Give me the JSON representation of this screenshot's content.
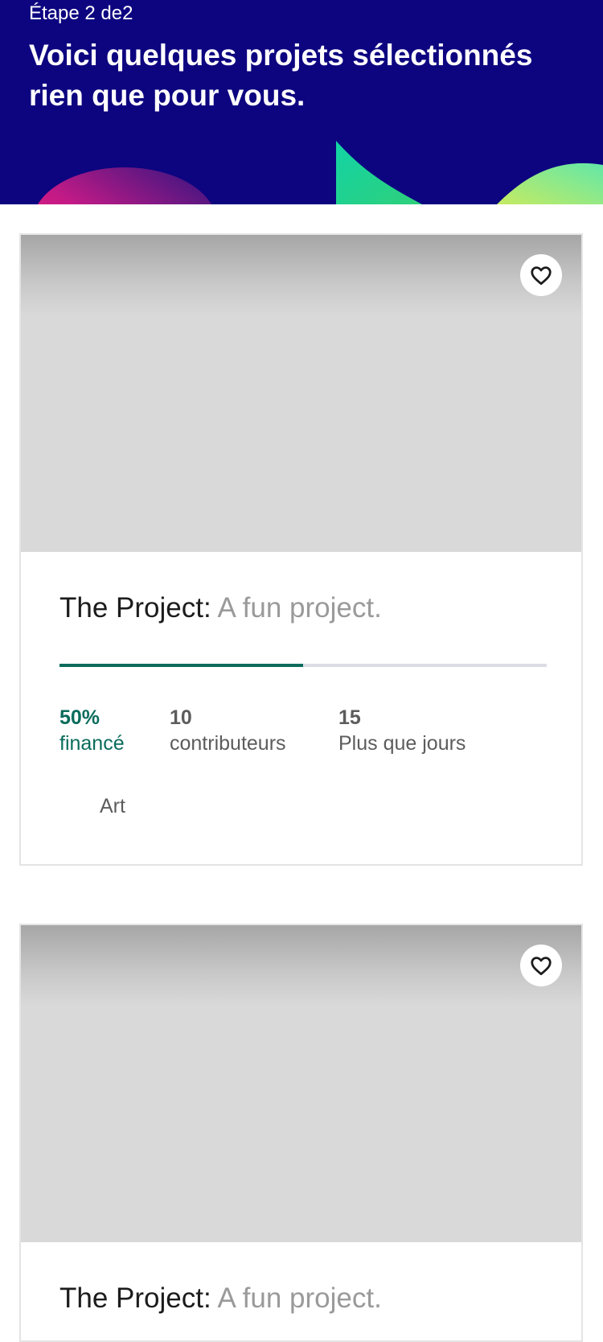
{
  "header": {
    "step": "Étape 2 de2",
    "headline": "Voici quelques projets sélectionnés rien que pour vous."
  },
  "colors": {
    "header_bg": "#0d0480",
    "funded_accent": "#0b6c5c"
  },
  "projects": [
    {
      "name": "The Project:",
      "description": "A fun project.",
      "funded_percent": "50%",
      "funded_label": "financé",
      "funded_fraction": 0.5,
      "contributors_count": "10",
      "contributors_label": "contributeurs",
      "days_count": "15",
      "days_label": "Plus que jours",
      "category": "Art",
      "favorite_icon": "heart-icon"
    },
    {
      "name": "The Project:",
      "description": "A fun project.",
      "favorite_icon": "heart-icon"
    }
  ]
}
